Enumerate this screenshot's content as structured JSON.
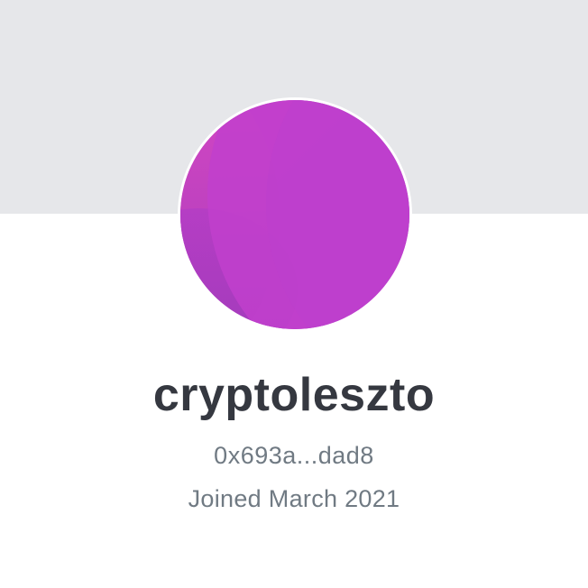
{
  "profile": {
    "username": "cryptoleszto",
    "wallet_address": "0x693a...dad8",
    "joined": "Joined March 2021"
  },
  "colors": {
    "banner": "#e6e7ea",
    "avatar_primary": "#c33fcb",
    "avatar_secondary": "#9a3bbc",
    "avatar_highlight": "#d648c8",
    "username_text": "#353840",
    "secondary_text": "#707a83"
  }
}
